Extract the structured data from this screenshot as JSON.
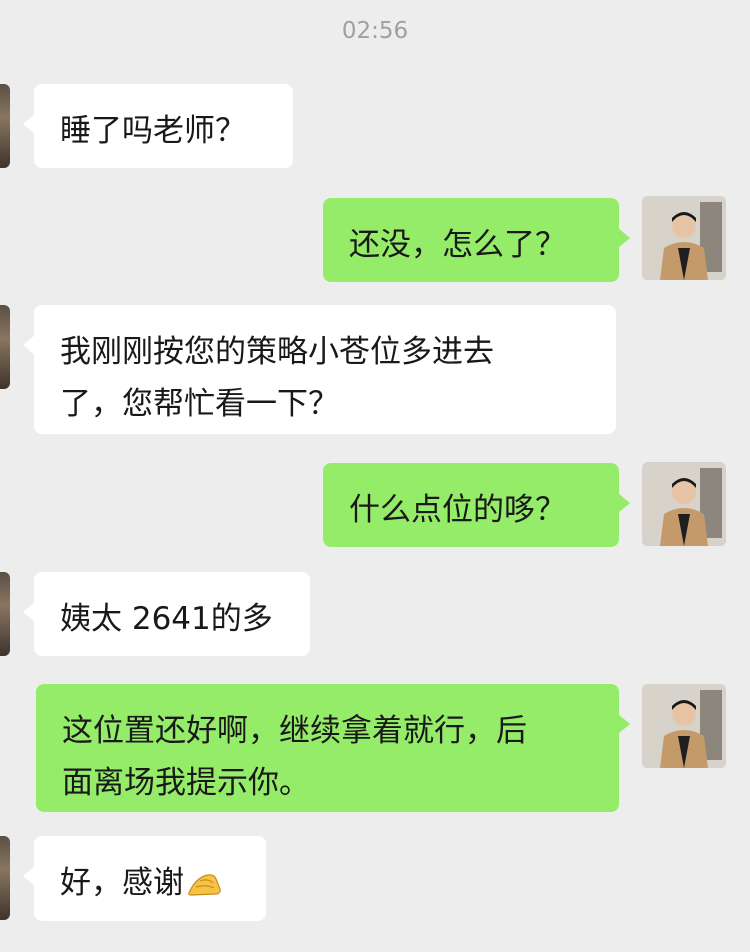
{
  "timestamp": "02:56",
  "messages": [
    {
      "side": "left",
      "text": "睡了吗老师？"
    },
    {
      "side": "right",
      "text": "还没，怎么了？"
    },
    {
      "side": "left",
      "lines": [
        "我刚刚按您的策略小苍位多进去",
        "了，您帮忙看一下？"
      ]
    },
    {
      "side": "right",
      "text": "什么点位的哆？"
    },
    {
      "side": "left",
      "text": "姨太 2641的多"
    },
    {
      "side": "right",
      "lines": [
        "这位置还好啊，继续拿着就行，后",
        "面离场我提示你。"
      ]
    },
    {
      "side": "left",
      "text": "好，感谢",
      "emoji": "pinched-fingers-icon"
    }
  ],
  "colors": {
    "background": "#ededed",
    "incoming_bubble": "#ffffff",
    "outgoing_bubble": "#95ec69",
    "timestamp": "#a0a0a0"
  }
}
